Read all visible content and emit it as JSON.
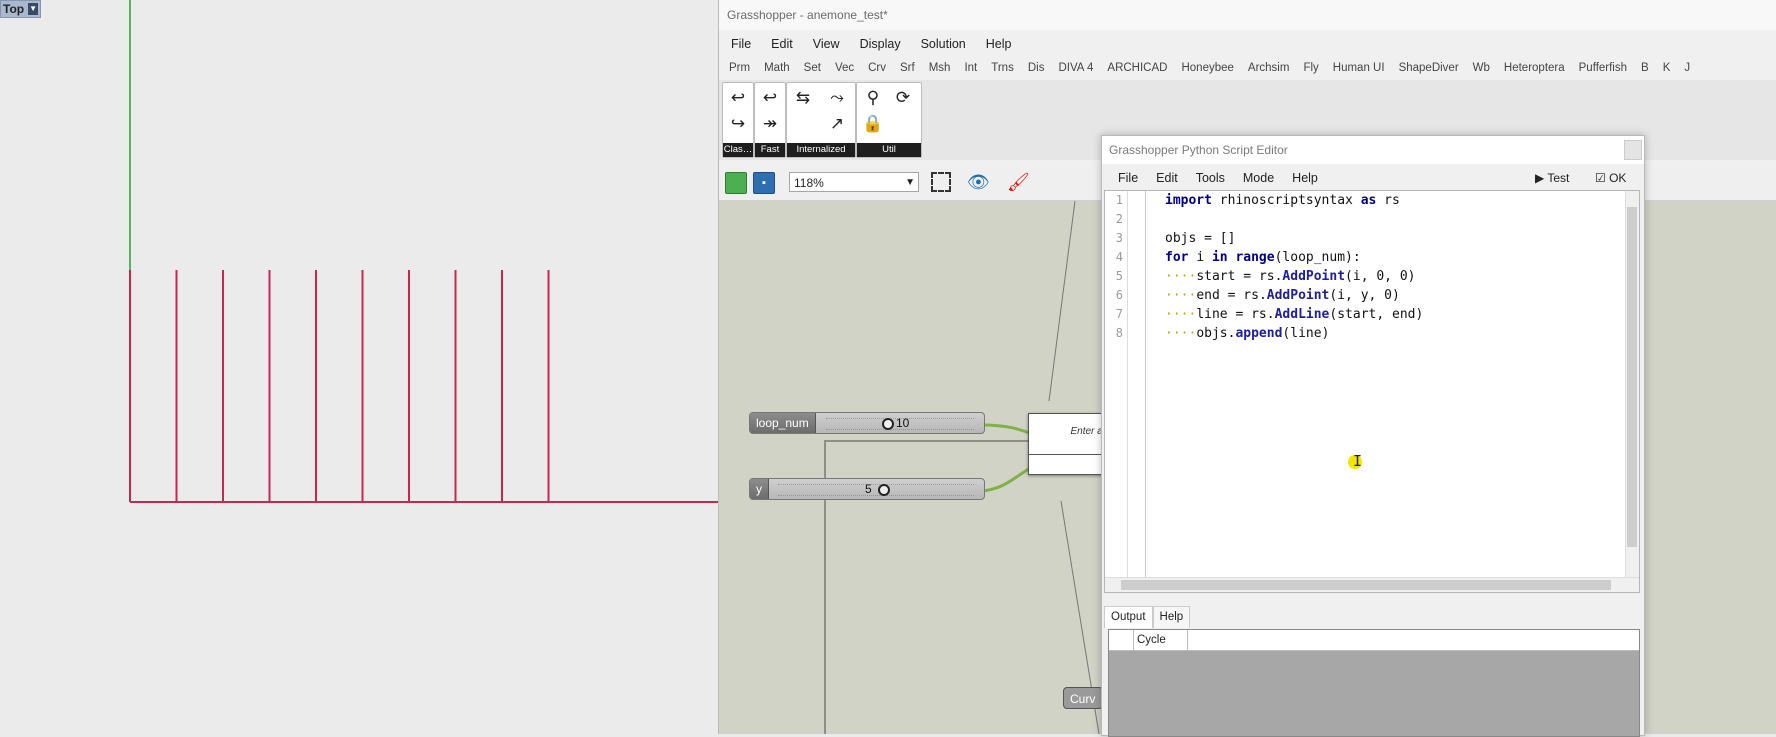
{
  "viewport": {
    "label": "Top"
  },
  "grasshopper": {
    "title": "Grasshopper - anemone_test*",
    "menu": [
      "File",
      "Edit",
      "View",
      "Display",
      "Solution",
      "Help"
    ],
    "tabs": [
      "Prm",
      "Math",
      "Set",
      "Vec",
      "Crv",
      "Srf",
      "Msh",
      "Int",
      "Trns",
      "Dis",
      "DIVA 4",
      "ARCHICAD",
      "Honeybee",
      "Archsim",
      "Fly",
      "Human UI",
      "ShapeDiver",
      "Wb",
      "Heteroptera",
      "Pufferfish",
      "B",
      "K",
      "J"
    ],
    "ribbon_groups": [
      "Clas…",
      "Fast",
      "Internalized",
      "Util"
    ],
    "zoom": "118%",
    "sliders": [
      {
        "name": "loop_num",
        "value": "10"
      },
      {
        "name": "y",
        "value": "5"
      }
    ],
    "component_partial": "Curv",
    "search_placeholder": "Enter a search keyword…"
  },
  "python_editor": {
    "title": "Grasshopper Python Script Editor",
    "menu": [
      "File",
      "Edit",
      "Tools",
      "Mode",
      "Help"
    ],
    "test_label": "Test",
    "ok_label": "OK",
    "line_numbers": [
      "1",
      "2",
      "3",
      "4",
      "5",
      "6",
      "7",
      "8"
    ],
    "code": [
      "import rhinoscriptsyntax as rs",
      "",
      "objs = []",
      "for i in range(loop_num):",
      "····start = rs.AddPoint(i, 0, 0)",
      "····end = rs.AddPoint(i, y, 0)",
      "····line = rs.AddLine(start, end)",
      "····objs.append(line)"
    ],
    "output_tabs": [
      "Output",
      "Help"
    ],
    "output_column": "Cycle"
  },
  "colors": {
    "green_axis": "#2e9e3b",
    "red_line": "#c8284f",
    "wire": "#7fb04a"
  }
}
